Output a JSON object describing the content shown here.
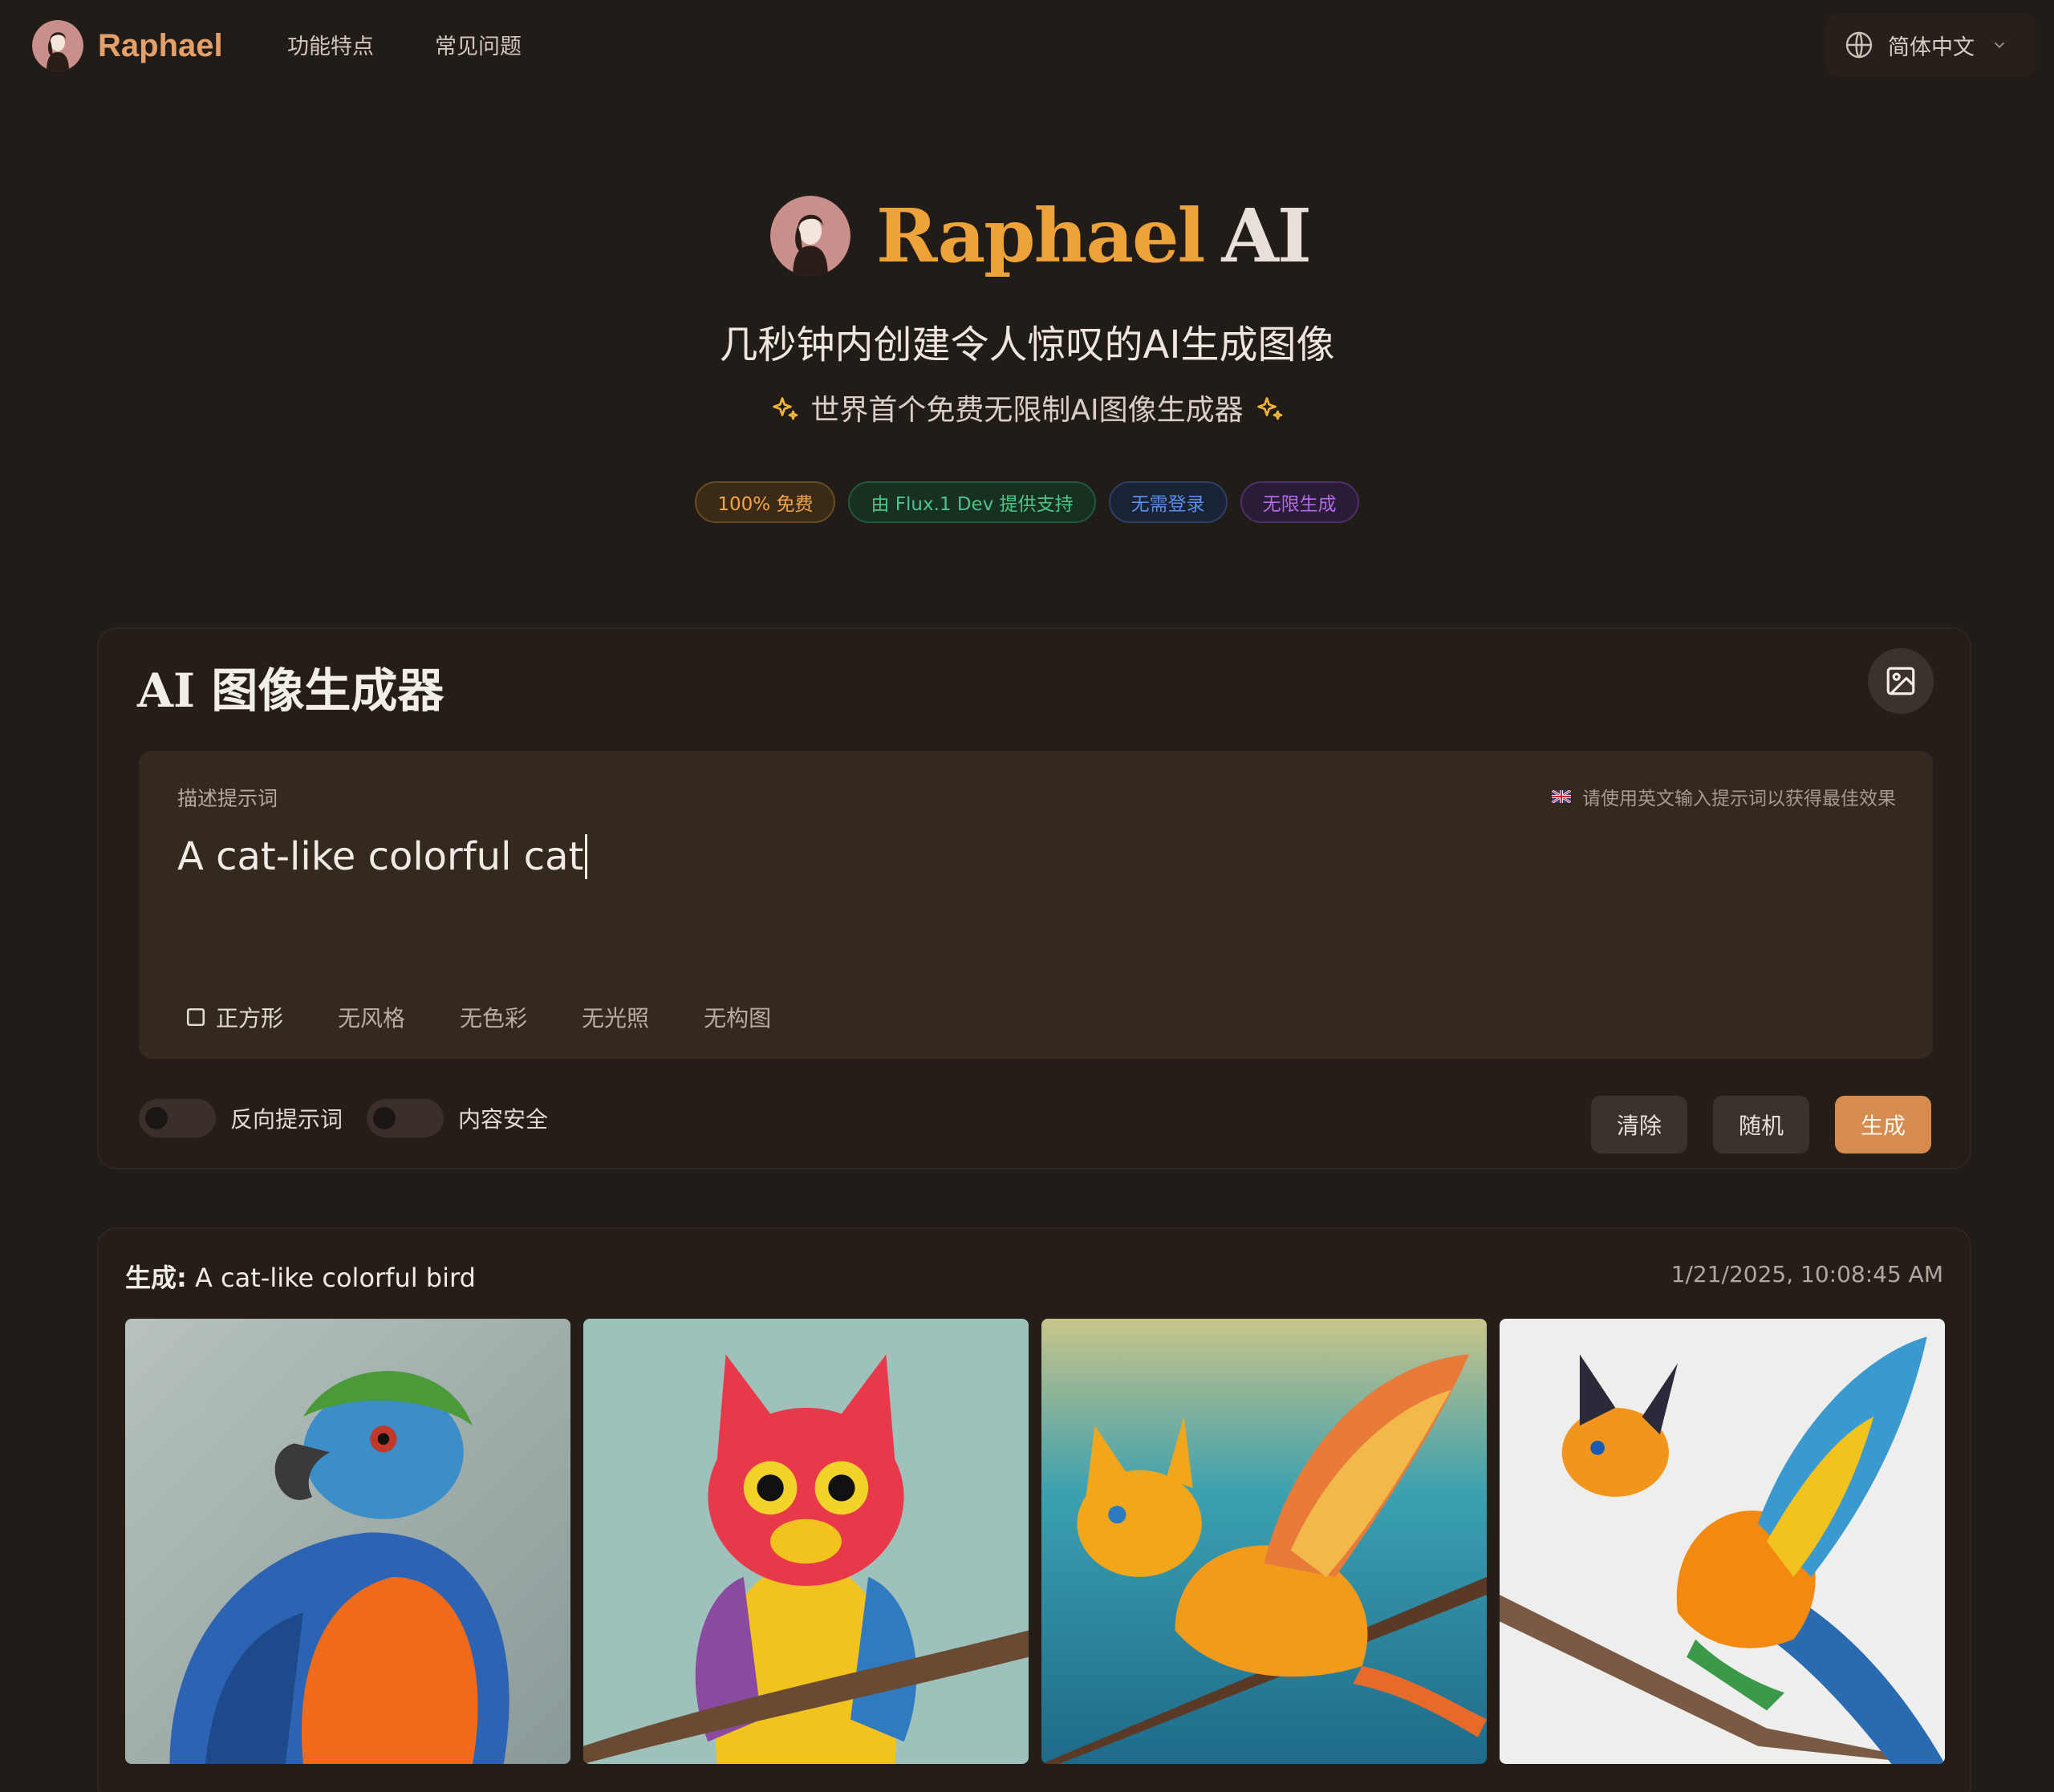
{
  "nav": {
    "brand": "Raphael",
    "links": [
      "功能特点",
      "常见问题"
    ],
    "language": "简体中文"
  },
  "hero": {
    "title_main": "Raphael",
    "title_suffix": "AI",
    "subtitle": "几秒钟内创建令人惊叹的AI生成图像",
    "tagline": "世界首个免费无限制AI图像生成器",
    "badges": [
      "100% 免费",
      "由 Flux.1 Dev 提供支持",
      "无需登录",
      "无限生成"
    ]
  },
  "generator": {
    "title": "AI 图像生成器",
    "prompt_label": "描述提示词",
    "prompt_hint": "请使用英文输入提示词以获得最佳效果",
    "prompt_value": "A cat-like colorful cat",
    "options": [
      "正方形",
      "无风格",
      "无色彩",
      "无光照",
      "无构图"
    ],
    "toggles": [
      "反向提示词",
      "内容安全"
    ],
    "buttons": {
      "clear": "清除",
      "random": "随机",
      "generate": "生成"
    }
  },
  "result": {
    "label": "生成:",
    "prompt": "A cat-like colorful bird",
    "timestamp": "1/21/2025, 10:08:45 AM"
  },
  "colors": {
    "accent": "#e4a06b",
    "title_gold": "#eda33a",
    "generate_button": "#d68c4e",
    "background": "#221c18"
  }
}
